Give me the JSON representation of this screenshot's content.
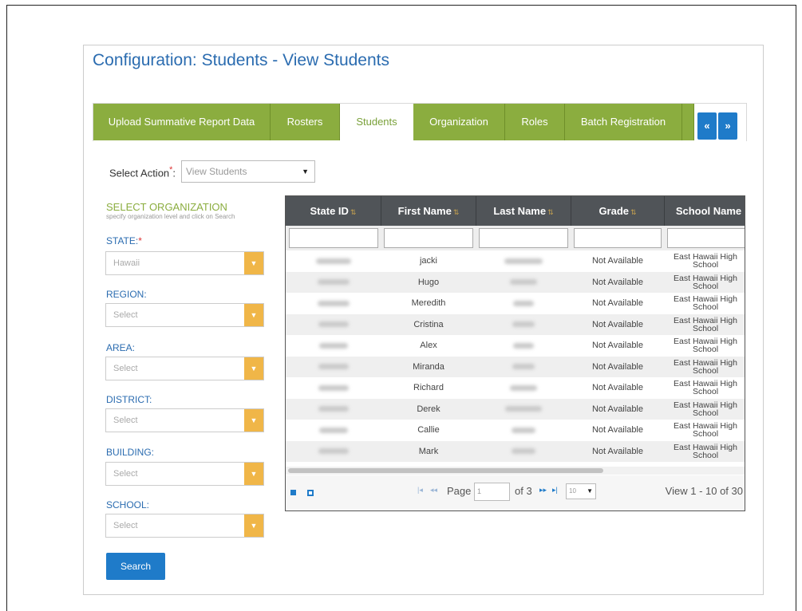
{
  "page": {
    "title": "Configuration: Students - View Students"
  },
  "tabs": [
    {
      "label": "Upload Summative Report Data"
    },
    {
      "label": "Rosters"
    },
    {
      "label": "Students",
      "active": true
    },
    {
      "label": "Organization"
    },
    {
      "label": "Roles"
    },
    {
      "label": "Batch Registration"
    }
  ],
  "tab_nav": {
    "prev": "«",
    "next": "»"
  },
  "action": {
    "label": "Select Action",
    "required_mark": "*",
    "colon": ":",
    "value": "View Students"
  },
  "org": {
    "title": "SELECT ORGANIZATION",
    "hint": "specify organization level and click on Search",
    "fields": [
      {
        "label": "STATE:",
        "required_mark": "*",
        "value": "Hawaii"
      },
      {
        "label": "REGION:",
        "value": "Select"
      },
      {
        "label": "AREA:",
        "value": "Select"
      },
      {
        "label": "DISTRICT:",
        "value": "Select"
      },
      {
        "label": "BUILDING:",
        "value": "Select"
      },
      {
        "label": "SCHOOL:",
        "value": "Select"
      }
    ],
    "search_label": "Search"
  },
  "grid": {
    "columns": [
      "State ID",
      "First Name",
      "Last Name",
      "Grade",
      "School Name"
    ],
    "rows": [
      {
        "first": "jacki",
        "grade": "Not Available",
        "school": "East Hawaii High School"
      },
      {
        "first": "Hugo",
        "grade": "Not Available",
        "school": "East Hawaii High School"
      },
      {
        "first": "Meredith",
        "grade": "Not Available",
        "school": "East Hawaii High School"
      },
      {
        "first": "Cristina",
        "grade": "Not Available",
        "school": "East Hawaii High School"
      },
      {
        "first": "Alex",
        "grade": "Not Available",
        "school": "East Hawaii High School"
      },
      {
        "first": "Miranda",
        "grade": "Not Available",
        "school": "East Hawaii High School"
      },
      {
        "first": "Richard",
        "grade": "Not Available",
        "school": "East Hawaii High School"
      },
      {
        "first": "Derek",
        "grade": "Not Available",
        "school": "East Hawaii High School"
      },
      {
        "first": "Callie",
        "grade": "Not Available",
        "school": "East Hawaii High School"
      },
      {
        "first": "Mark",
        "grade": "Not Available",
        "school": "East Hawaii High School"
      }
    ]
  },
  "pager": {
    "page_label": "Page",
    "page_value": "1",
    "of_label": "of 3",
    "rows_per_page": "10",
    "view_text": "View 1 - 10 of 30"
  },
  "colors": {
    "accent_green": "#8bad3f",
    "primary_blue": "#1f7bc9",
    "dropdown_orange": "#f0b648",
    "header_dark": "#505458"
  }
}
